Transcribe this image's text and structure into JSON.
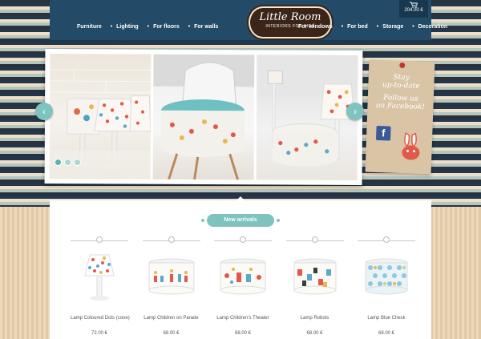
{
  "header": {
    "nav_left": [
      "Furniture",
      "Lighting",
      "For floors",
      "For walls"
    ],
    "nav_right": [
      "For windows",
      "For bed",
      "Storage",
      "Decoration"
    ],
    "logo_title": "Little Room",
    "logo_subtitle": "INTERIORS FOR KIDS",
    "cart_total": "204.00 €",
    "cart_icon": "shopping-cart-icon"
  },
  "slider": {
    "prev_icon": "chevron-left-icon",
    "next_icon": "chevron-right-icon",
    "slide_count": 3,
    "active_slide": 1
  },
  "social": {
    "lines": [
      "Stay",
      "up-to-date",
      "Follow us",
      "on Facebook!"
    ],
    "facebook_icon": "facebook-icon",
    "facebook_glyph": "f"
  },
  "main": {
    "section_title": "New arrivals",
    "products": [
      {
        "name": "Lamp Coloured Dots (cone)",
        "price": "72.00 €"
      },
      {
        "name": "Lamp Children on Parade",
        "price": "68.00 €"
      },
      {
        "name": "Lamp Children's Theater",
        "price": "68.00 €"
      },
      {
        "name": "Lamp Robots",
        "price": "68.00 €"
      },
      {
        "name": "Lamp Blue Check",
        "price": "68.00 €"
      }
    ]
  },
  "colors": {
    "header_bg": "#234a66",
    "accent_teal": "#7fc3c0",
    "logo_bg": "#3b2418"
  }
}
